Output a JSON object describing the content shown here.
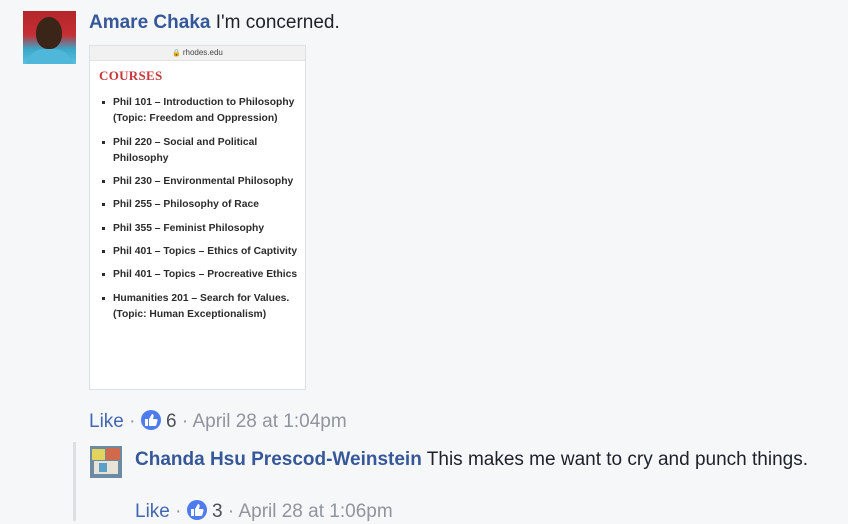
{
  "comment": {
    "author": "Amare Chaka",
    "text": "I'm concerned.",
    "attachment": {
      "url": "rhodes.edu",
      "heading": "COURSES",
      "courses": [
        "Phil 101 – Introduction to Philosophy (Topic: Freedom and Oppression)",
        "Phil 220 – Social and Political Philosophy",
        "Phil 230 – Environmental Philosophy",
        "Phil 255 – Philosophy of Race",
        "Phil 355 – Feminist Philosophy",
        "Phil 401 – Topics – Ethics of Captivity",
        "Phil 401 – Topics – Procreative Ethics",
        "Humanities 201 – Search for Values. (Topic: Human Exceptionalism)"
      ]
    },
    "like_label": "Like",
    "separator": "·",
    "reaction_count": "6",
    "timestamp": "April 28 at 1:04pm"
  },
  "reply": {
    "author": "Chanda Hsu Prescod-Weinstein",
    "text": "This makes me want to cry and punch things.",
    "like_label": "Like",
    "separator": "·",
    "reaction_count": "3",
    "timestamp": "April 28 at 1:06pm"
  },
  "icons": {
    "reaction": "like-thumb-icon",
    "lock": "lock-icon"
  },
  "colors": {
    "author_link": "#365899",
    "like_link": "#4267b2",
    "courses_heading": "#c8373b",
    "reaction_badge": "#4f7bf0"
  }
}
